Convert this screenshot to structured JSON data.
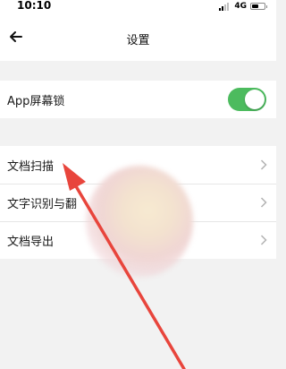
{
  "status_bar": {
    "time": "10:10",
    "network": "4G",
    "signal_bars_active": 2,
    "signal_bars_total": 4,
    "battery_level": 0.55
  },
  "header": {
    "title": "设置",
    "back_icon": "arrow-left-icon"
  },
  "settings": {
    "app_lock": {
      "label": "App屏幕锁",
      "toggle_on": true,
      "toggle_color": "#4cbb5e"
    },
    "items": [
      {
        "label": "文档扫描",
        "icon": "chevron-right-icon"
      },
      {
        "label": "文字识别与翻",
        "icon": "chevron-right-icon"
      },
      {
        "label": "文档导出",
        "icon": "chevron-right-icon"
      }
    ]
  },
  "annotation": {
    "arrow_color": "#e8453c"
  }
}
